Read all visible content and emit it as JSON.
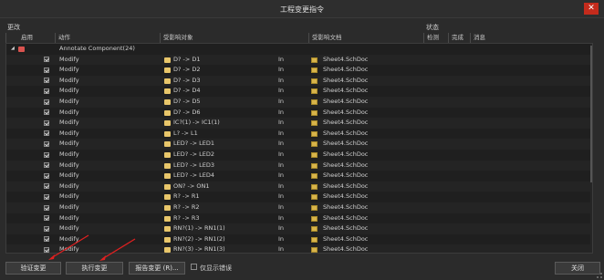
{
  "window": {
    "title": "工程变更指令",
    "close_glyph": "✕"
  },
  "sections": {
    "changes": "更改",
    "status": "状态"
  },
  "columns": {
    "enable": "启用",
    "action": "动作",
    "affected_object": "受影响对象",
    "affected_document": "受影响文档",
    "check": "检测",
    "done": "完成",
    "message": "消息"
  },
  "group": {
    "label": "Annotate Component(24)"
  },
  "rows": [
    {
      "action": "Modify",
      "object": "D? -> D1",
      "in": "In",
      "doc": "Sheet4.SchDoc"
    },
    {
      "action": "Modify",
      "object": "D? -> D2",
      "in": "In",
      "doc": "Sheet4.SchDoc"
    },
    {
      "action": "Modify",
      "object": "D? -> D3",
      "in": "In",
      "doc": "Sheet4.SchDoc"
    },
    {
      "action": "Modify",
      "object": "D? -> D4",
      "in": "In",
      "doc": "Sheet4.SchDoc"
    },
    {
      "action": "Modify",
      "object": "D? -> D5",
      "in": "In",
      "doc": "Sheet4.SchDoc"
    },
    {
      "action": "Modify",
      "object": "D? -> D6",
      "in": "In",
      "doc": "Sheet4.SchDoc"
    },
    {
      "action": "Modify",
      "object": "IC?(1) -> IC1(1)",
      "in": "In",
      "doc": "Sheet4.SchDoc"
    },
    {
      "action": "Modify",
      "object": "L? -> L1",
      "in": "In",
      "doc": "Sheet4.SchDoc"
    },
    {
      "action": "Modify",
      "object": "LED? -> LED1",
      "in": "In",
      "doc": "Sheet4.SchDoc"
    },
    {
      "action": "Modify",
      "object": "LED? -> LED2",
      "in": "In",
      "doc": "Sheet4.SchDoc"
    },
    {
      "action": "Modify",
      "object": "LED? -> LED3",
      "in": "In",
      "doc": "Sheet4.SchDoc"
    },
    {
      "action": "Modify",
      "object": "LED? -> LED4",
      "in": "In",
      "doc": "Sheet4.SchDoc"
    },
    {
      "action": "Modify",
      "object": "ON? -> ON1",
      "in": "In",
      "doc": "Sheet4.SchDoc"
    },
    {
      "action": "Modify",
      "object": "R? -> R1",
      "in": "In",
      "doc": "Sheet4.SchDoc"
    },
    {
      "action": "Modify",
      "object": "R? -> R2",
      "in": "In",
      "doc": "Sheet4.SchDoc"
    },
    {
      "action": "Modify",
      "object": "R? -> R3",
      "in": "In",
      "doc": "Sheet4.SchDoc"
    },
    {
      "action": "Modify",
      "object": "RN?(1) -> RN1(1)",
      "in": "In",
      "doc": "Sheet4.SchDoc"
    },
    {
      "action": "Modify",
      "object": "RN?(2) -> RN1(2)",
      "in": "In",
      "doc": "Sheet4.SchDoc"
    },
    {
      "action": "Modify",
      "object": "RN?(3) -> RN1(3)",
      "in": "In",
      "doc": "Sheet4.SchDoc"
    }
  ],
  "buttons": {
    "validate": "验证变更",
    "execute": "执行变更",
    "report": "报告变更 (R)...",
    "close": "关闭"
  },
  "option": {
    "only_errors": "仅显示错误"
  },
  "colors": {
    "annotation_arrow": "#e02020",
    "close_button": "#c42b1c"
  }
}
